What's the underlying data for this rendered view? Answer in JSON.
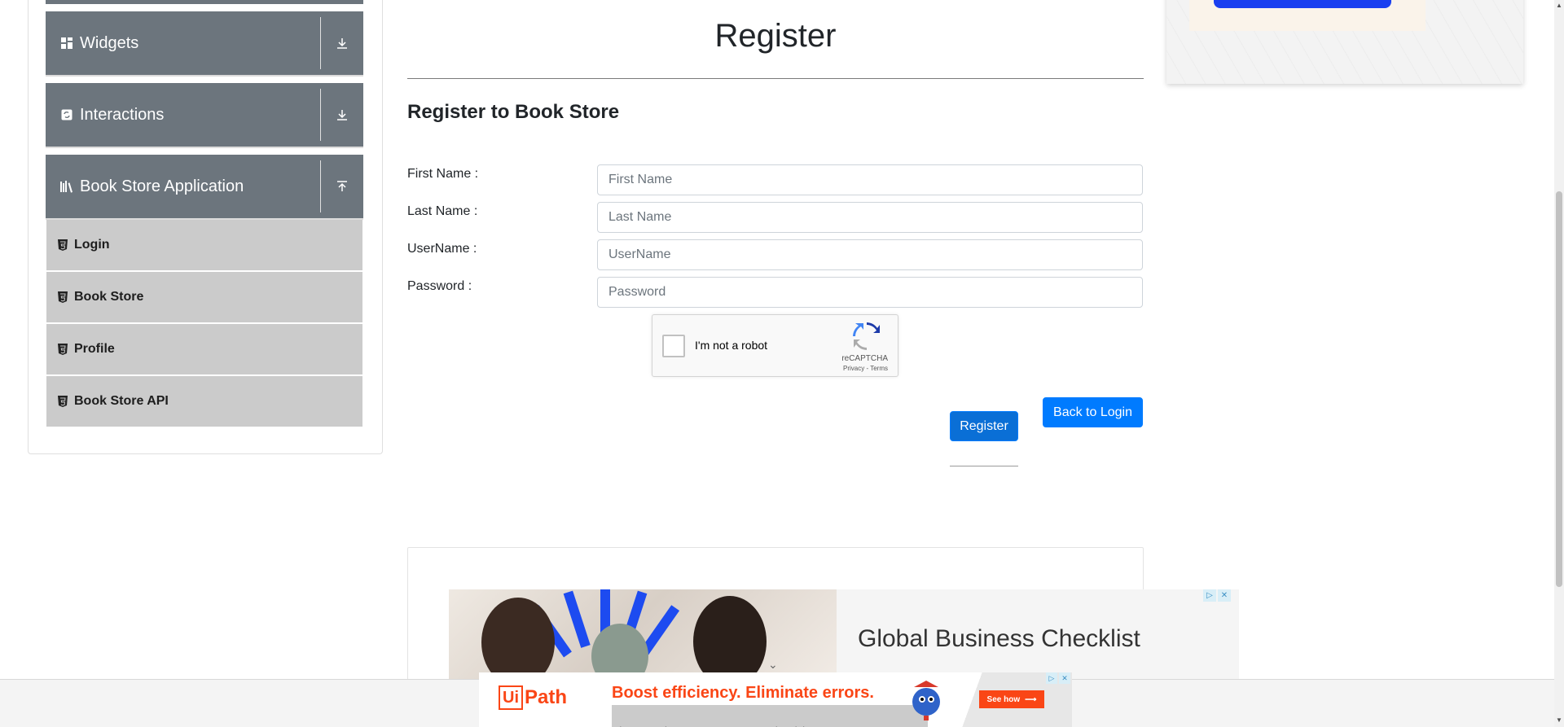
{
  "sidebar": {
    "groups": [
      {
        "label": "Widgets",
        "icon": "widgets-grid-icon",
        "arrow": "expand-down-icon"
      },
      {
        "label": "Interactions",
        "icon": "interactions-icon",
        "arrow": "expand-down-icon"
      },
      {
        "label": "Book Store Application",
        "icon": "books-icon",
        "arrow": "collapse-up-icon"
      }
    ],
    "items": [
      {
        "label": "Login",
        "icon": "html5-badge-icon"
      },
      {
        "label": "Book Store",
        "icon": "html5-badge-icon"
      },
      {
        "label": "Profile",
        "icon": "html5-badge-icon"
      },
      {
        "label": "Book Store API",
        "icon": "html5-badge-icon"
      }
    ]
  },
  "main": {
    "header": "Register",
    "subtitle": "Register to Book Store",
    "fields": [
      {
        "label": "First Name :",
        "placeholder": "First Name",
        "value": ""
      },
      {
        "label": "Last Name :",
        "placeholder": "Last Name",
        "value": ""
      },
      {
        "label": "UserName :",
        "placeholder": "UserName",
        "value": ""
      },
      {
        "label": "Password :",
        "placeholder": "Password",
        "value": ""
      }
    ],
    "recaptcha": {
      "label": "I'm not a robot",
      "brand": "reCAPTCHA",
      "links": "Privacy - Terms",
      "checked": false
    },
    "register_button": "Register",
    "back_button": "Back to Login"
  },
  "ads": {
    "banner": {
      "headline": "Global Business Checklist"
    },
    "bottom": {
      "brand_ui": "Ui",
      "brand_path": "Path",
      "headline": "Boost efficiency. Eliminate errors.",
      "subtext": "Discover a better way to automate invoicing",
      "cta": "See how"
    }
  },
  "colors": {
    "sidebar_group": "#6c757d",
    "sidebar_item": "#cbcbcb",
    "primary": "#007bff",
    "uipath": "#fa4616"
  }
}
